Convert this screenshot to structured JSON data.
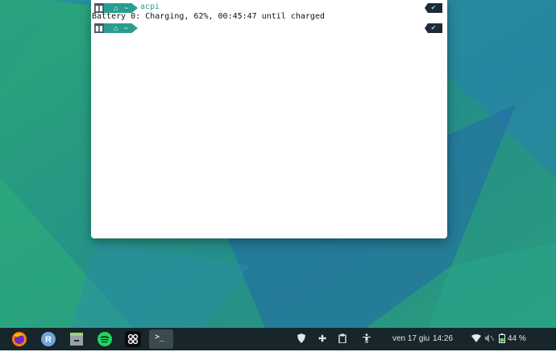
{
  "terminal": {
    "prompt1": {
      "os_icon": "linux-icon",
      "home_icon": "home-icon",
      "dir": "~",
      "command": "acpi",
      "status_icon": "check-icon",
      "status_glyph": "✔"
    },
    "output": "Battery 0: Charging, 62%, 00:45:47 until charged",
    "prompt2": {
      "os_icon": "linux-icon",
      "home_icon": "home-icon",
      "dir": "~",
      "command": "",
      "status_icon": "check-icon",
      "status_glyph": "✔"
    }
  },
  "taskbar": {
    "apps": [
      {
        "name": "firefox-icon"
      },
      {
        "name": "r-app-icon",
        "label": "R"
      },
      {
        "name": "file-manager-icon"
      },
      {
        "name": "spotify-icon"
      },
      {
        "name": "network-app-icon"
      },
      {
        "name": "terminal-icon",
        "label": ">_"
      }
    ],
    "tray": {
      "date": "ven 17 giu",
      "time": "14:26",
      "battery": "44 %"
    }
  },
  "colors": {
    "prompt_accent": "#2a9d8f",
    "taskbar_bg": "#16262b",
    "desktop_primary": "#1f6f8b"
  }
}
